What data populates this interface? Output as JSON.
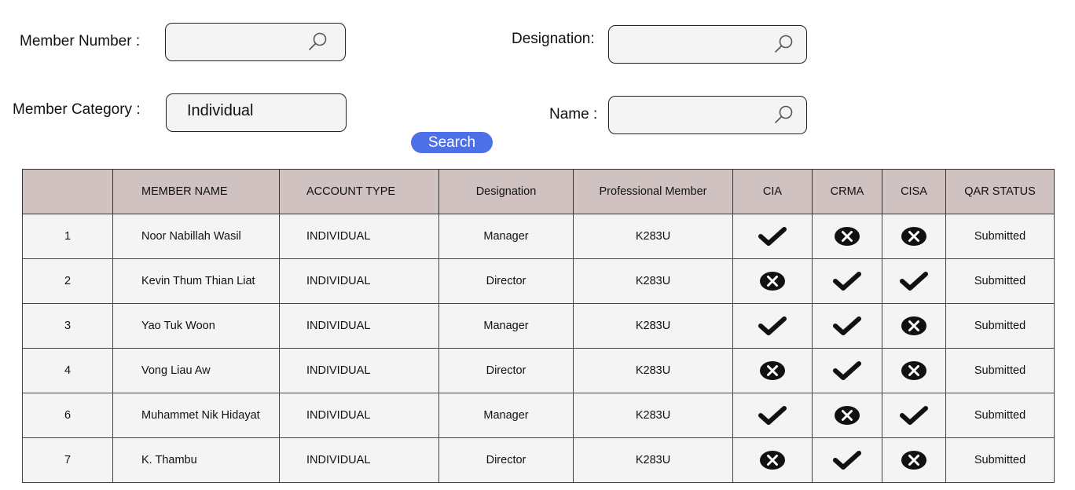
{
  "filters": {
    "member_number_label": "Member Number :",
    "designation_label": "Designation:",
    "member_category_label": "Member Category :",
    "member_category_value": "Individual",
    "name_label": "Name :",
    "member_number_value": "",
    "designation_value": "",
    "name_value": "",
    "search_icon": "magnifier-icon"
  },
  "search_button": "Search",
  "table": {
    "headers": [
      "",
      "MEMBER NAME",
      "ACCOUNT TYPE",
      "Designation",
      "Professional Member",
      "CIA",
      "CRMA",
      "CISA",
      "QAR STATUS"
    ],
    "status_icons": {
      "yes": "check-icon",
      "no": "cross-circle-icon"
    },
    "rows": [
      {
        "no": "1",
        "name": "Noor Nabillah Wasil",
        "account": "INDIVIDUAL",
        "designation": "Manager",
        "pro": "K283U",
        "cia": "yes",
        "crma": "no",
        "cisa": "no",
        "qar": "Submitted"
      },
      {
        "no": "2",
        "name": "Kevin Thum Thian Liat",
        "account": "INDIVIDUAL",
        "designation": "Director",
        "pro": "K283U",
        "cia": "no",
        "crma": "yes",
        "cisa": "yes",
        "qar": "Submitted"
      },
      {
        "no": "3",
        "name": "Yao Tuk Woon",
        "account": "INDIVIDUAL",
        "designation": "Manager",
        "pro": "K283U",
        "cia": "yes",
        "crma": "yes",
        "cisa": "no",
        "qar": "Submitted"
      },
      {
        "no": "4",
        "name": "Vong Liau Aw",
        "account": "INDIVIDUAL",
        "designation": "Director",
        "pro": "K283U",
        "cia": "no",
        "crma": "yes",
        "cisa": "no",
        "qar": "Submitted"
      },
      {
        "no": "6",
        "name": "Muhammet Nik Hidayat",
        "account": "INDIVIDUAL",
        "designation": "Manager",
        "pro": "K283U",
        "cia": "yes",
        "crma": "no",
        "cisa": "yes",
        "qar": "Submitted"
      },
      {
        "no": "7",
        "name": "K. Thambu",
        "account": "INDIVIDUAL",
        "designation": "Director",
        "pro": "K283U",
        "cia": "no",
        "crma": "yes",
        "cisa": "no",
        "qar": "Submitted"
      }
    ]
  }
}
